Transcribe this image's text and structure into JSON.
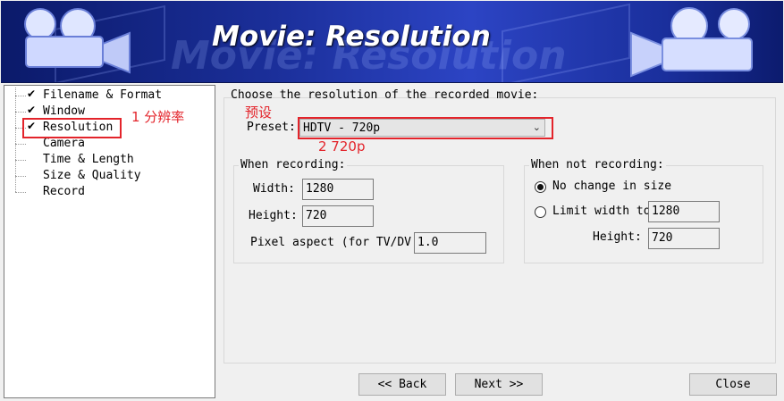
{
  "banner": {
    "title": "Movie: Resolution"
  },
  "tree": {
    "items": [
      {
        "label": "Filename & Format",
        "checked": true
      },
      {
        "label": "Window",
        "checked": true
      },
      {
        "label": "Resolution",
        "checked": true
      },
      {
        "label": "Camera",
        "checked": false
      },
      {
        "label": "Time & Length",
        "checked": false
      },
      {
        "label": "Size & Quality",
        "checked": false
      },
      {
        "label": "Record",
        "checked": false
      }
    ]
  },
  "main": {
    "prompt": "Choose the resolution of the recorded movie:",
    "preset_label": "Preset:",
    "preset_value": "HDTV - 720p",
    "when_recording": {
      "title": "When recording:",
      "width_label": "Width:",
      "width_value": "1280",
      "height_label": "Height:",
      "height_value": "720",
      "aspect_label": "Pixel aspect (for TV/DV",
      "aspect_value": "1.0"
    },
    "when_not_recording": {
      "title": "When not recording:",
      "no_change_label": "No change in size",
      "limit_label": "Limit width to",
      "limit_value": "1280",
      "height_label": "Height:",
      "height_value": "720",
      "selected": "no_change"
    }
  },
  "buttons": {
    "back": "<< Back",
    "next": "Next >>",
    "close": "Close"
  },
  "annotations": {
    "step1": "1 分辨率",
    "preset_note": "预设",
    "step2": "2 720p",
    "color": "#e3242b"
  }
}
